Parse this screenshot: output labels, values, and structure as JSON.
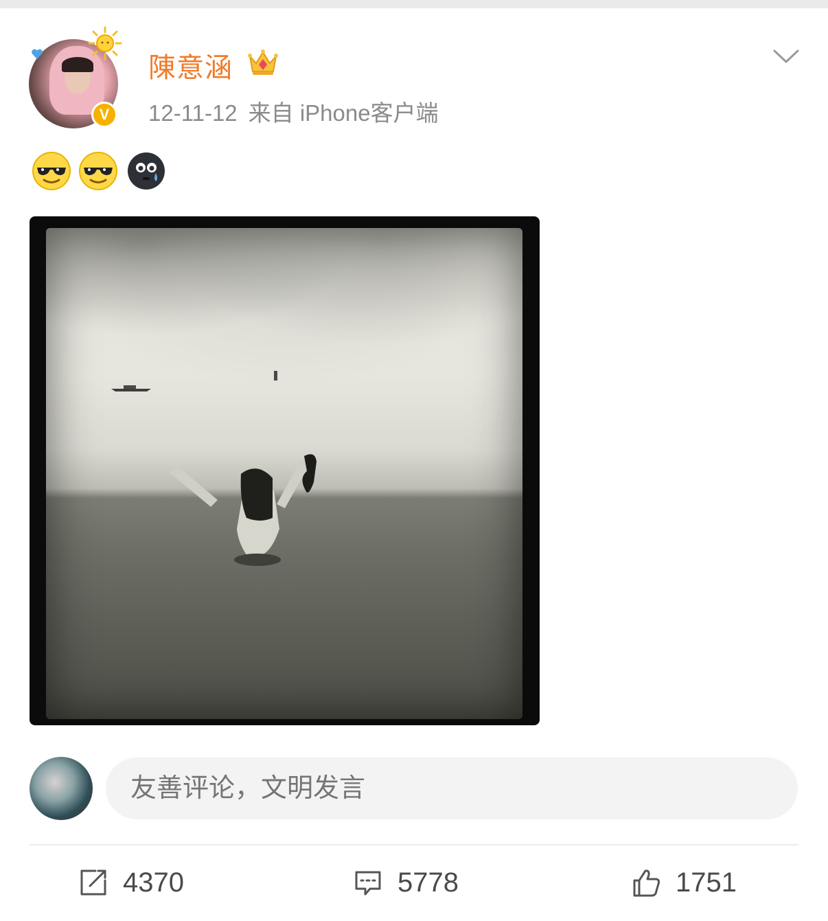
{
  "post": {
    "username": "陳意涵",
    "timestamp": "12-11-12",
    "source": "来自 iPhone客户端",
    "verified_badge": "V",
    "emojis": [
      "cool-sunglasses-emoji",
      "cool-sunglasses-emoji",
      "crying-emoji"
    ],
    "colors": {
      "username": "#f07b2a",
      "badge": "#f6b100"
    }
  },
  "comment_box": {
    "placeholder": "友善评论，文明发言"
  },
  "actions": {
    "repost_count": "4370",
    "comment_count": "5778",
    "like_count": "1751"
  }
}
